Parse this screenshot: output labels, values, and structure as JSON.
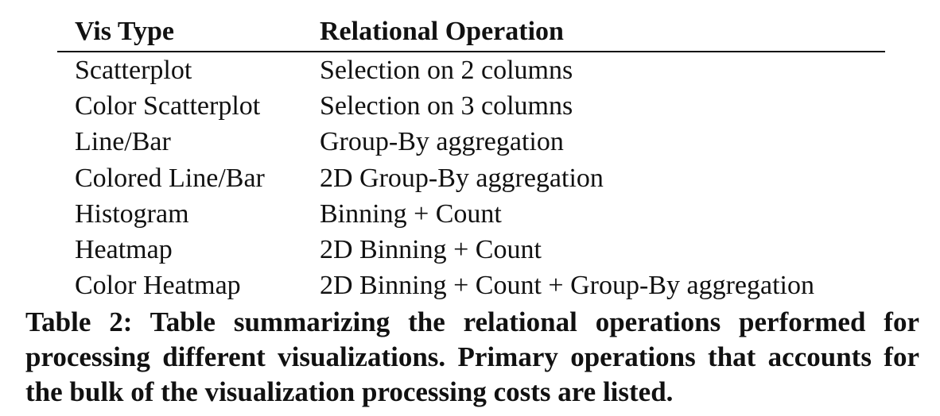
{
  "table": {
    "headers": [
      "Vis Type",
      "Relational Operation"
    ],
    "rows": [
      [
        "Scatterplot",
        "Selection on 2 columns"
      ],
      [
        "Color Scatterplot",
        "Selection on 3 columns"
      ],
      [
        "Line/Bar",
        "Group-By aggregation"
      ],
      [
        "Colored Line/Bar",
        "2D Group-By aggregation"
      ],
      [
        "Histogram",
        "Binning + Count"
      ],
      [
        "Heatmap",
        "2D Binning + Count"
      ],
      [
        "Color Heatmap",
        "2D Binning + Count + Group-By aggregation"
      ]
    ]
  },
  "caption": "Table 2: Table summarizing the relational operations performed for processing different visualizations. Primary operations that accounts for the bulk of the visualization processing costs are listed."
}
